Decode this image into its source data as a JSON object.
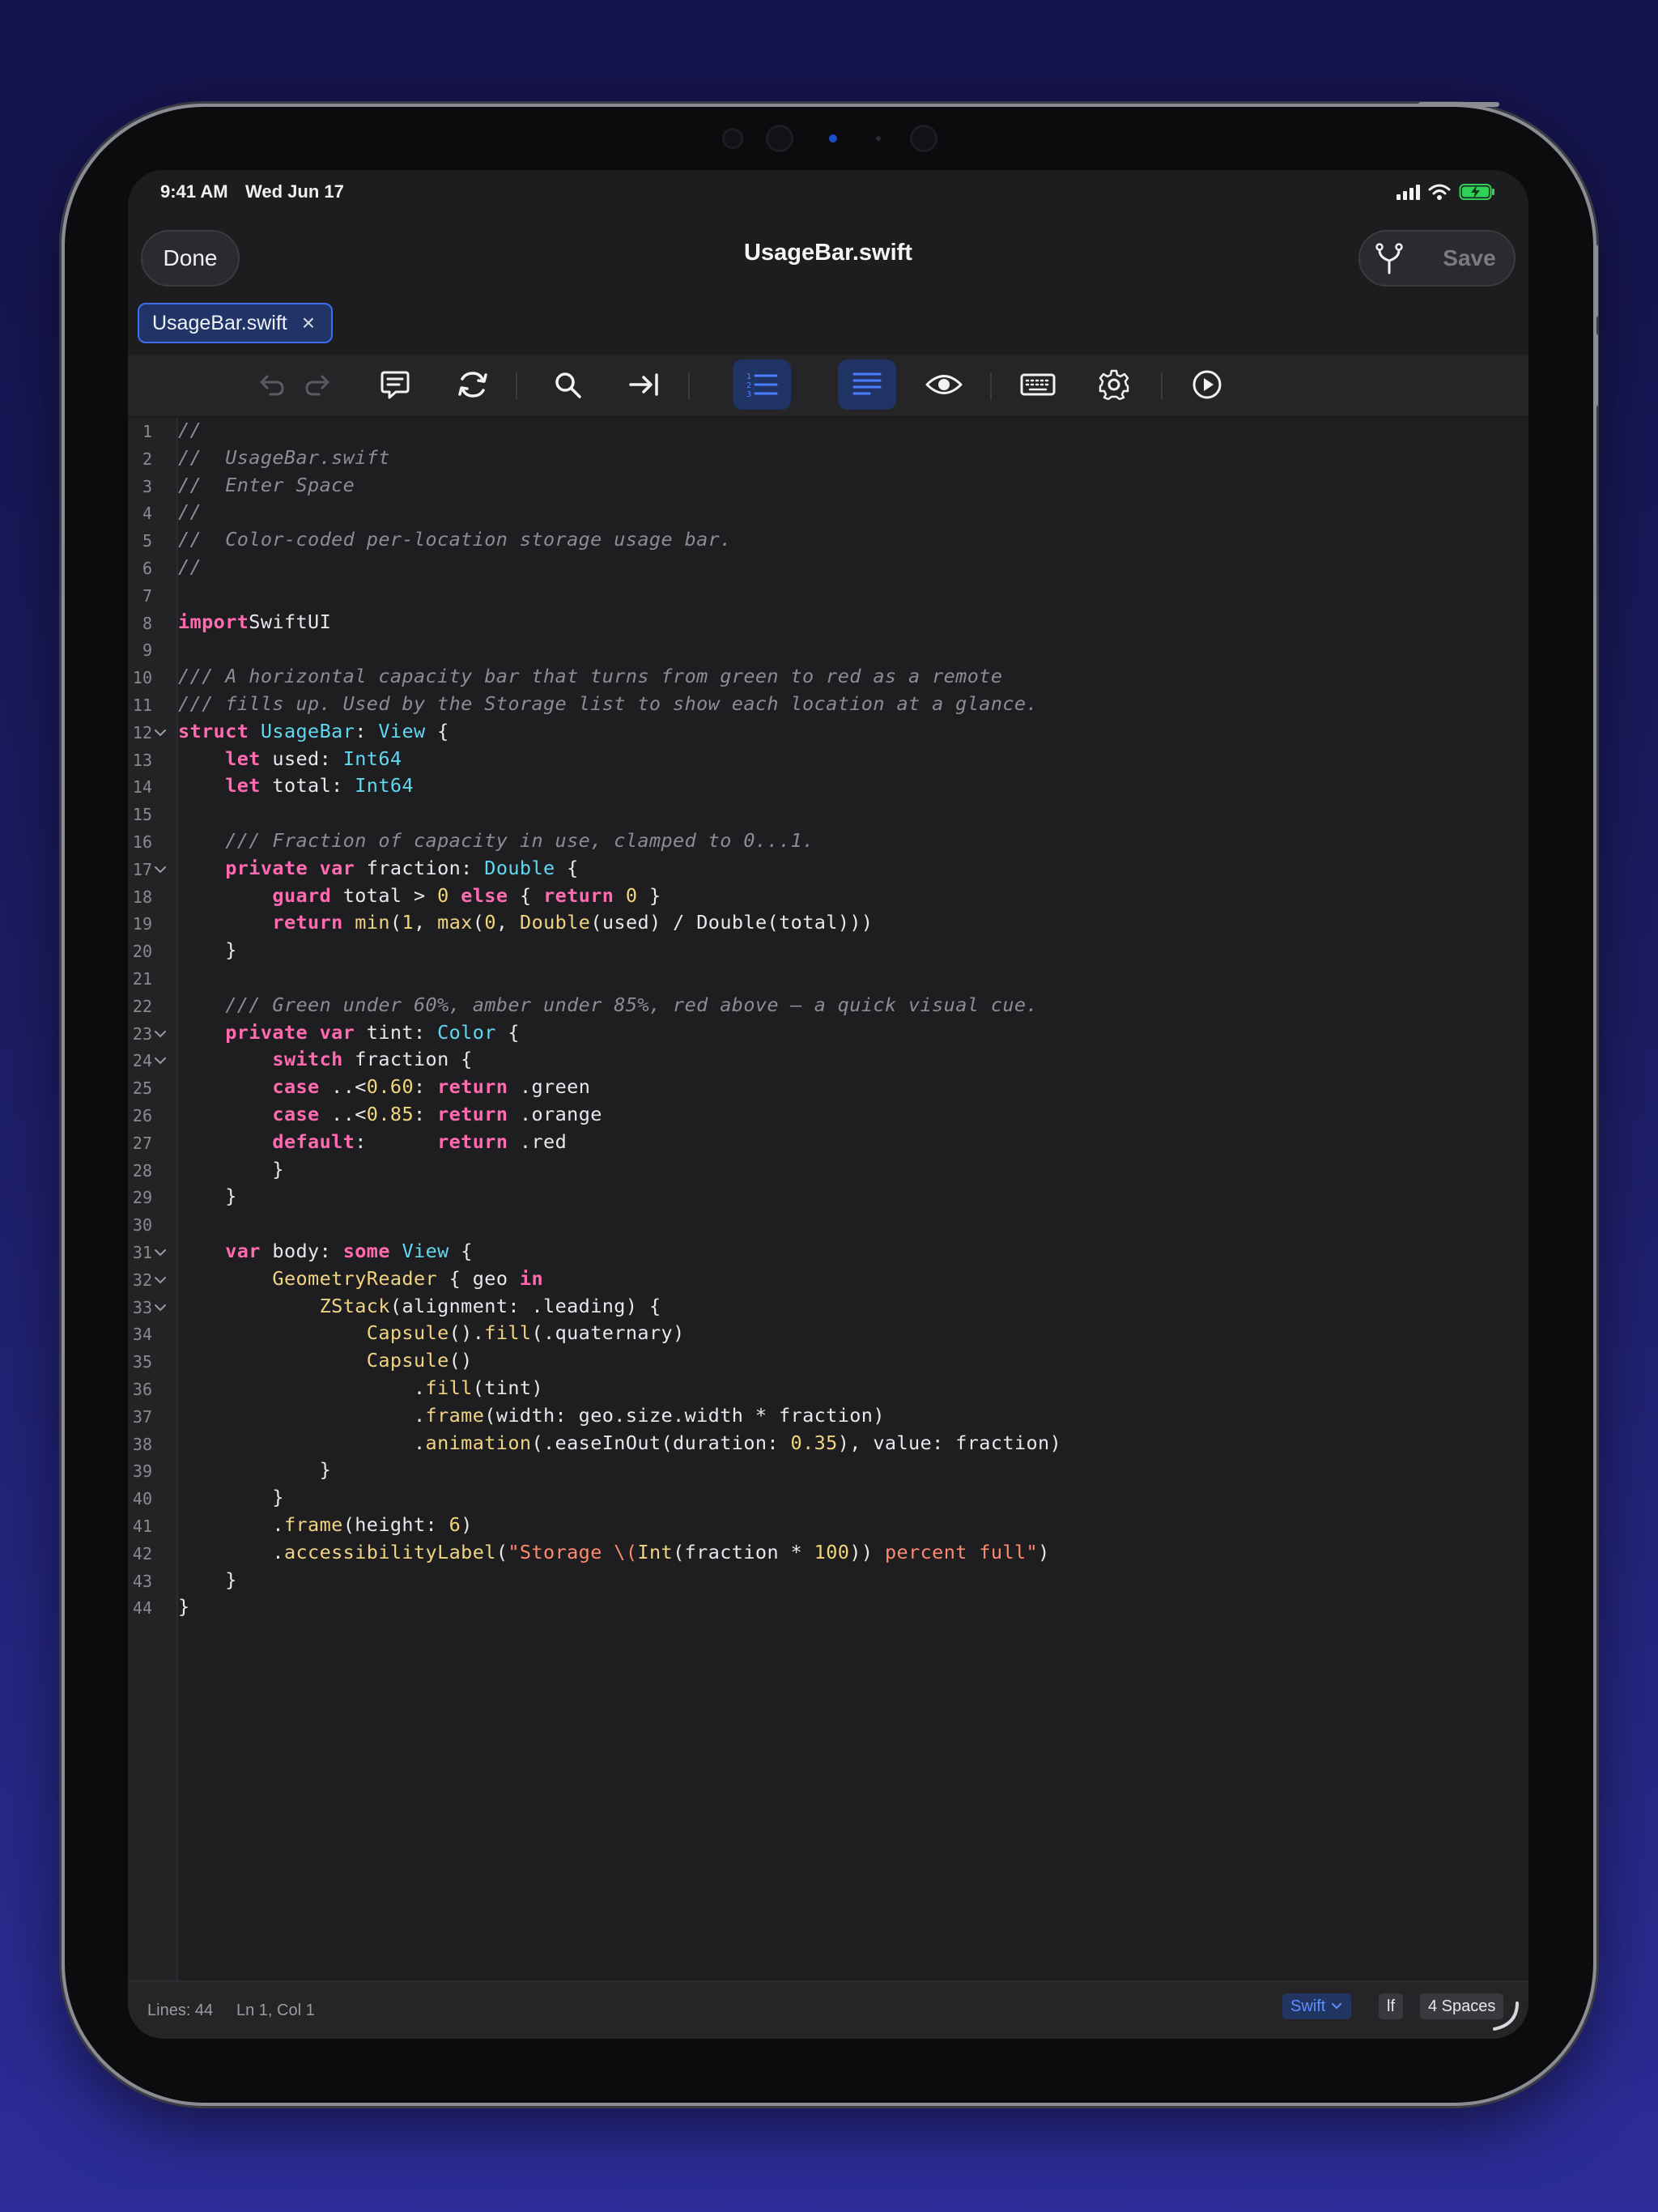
{
  "status_bar": {
    "time": "9:41 AM",
    "date": "Wed Jun 17"
  },
  "nav": {
    "done_label": "Done",
    "title": "UsageBar.swift",
    "save_label": "Save"
  },
  "tab": {
    "name": "UsageBar.swift",
    "close_glyph": "×"
  },
  "toolbar": {
    "icons": [
      "undo-icon",
      "redo-icon",
      "comment-icon",
      "refresh-icon",
      "search-icon",
      "indent-icon",
      "line-numbers-icon",
      "word-wrap-icon",
      "preview-eye-icon",
      "keyboard-icon",
      "gear-icon",
      "run-icon"
    ],
    "active": [
      "line-numbers-icon",
      "word-wrap-icon"
    ],
    "accent": "#4a7dff"
  },
  "editor": {
    "language": "Swift",
    "colors": {
      "comment": "#8a8d96",
      "keyword": "#ff6ab0",
      "type": "#5fd8f0",
      "function": "#f0d482",
      "number": "#f2d77a",
      "string": "#ff8a6e"
    },
    "fold_lines": [
      12,
      17,
      23,
      24,
      31,
      32,
      33
    ],
    "lines": [
      [
        [
          "cm",
          "//"
        ]
      ],
      [
        [
          "cm",
          "//  UsageBar.swift"
        ]
      ],
      [
        [
          "cm",
          "//  Enter Space"
        ]
      ],
      [
        [
          "cm",
          "//"
        ]
      ],
      [
        [
          "cm",
          "//  Color-coded per-location storage usage bar."
        ]
      ],
      [
        [
          "cm",
          "//"
        ]
      ],
      [],
      [
        [
          "kw",
          "import"
        ],
        [
          "",
          "SwiftUI"
        ]
      ],
      [],
      [
        [
          "cm",
          "/// A horizontal capacity bar that turns from green to red as a remote"
        ]
      ],
      [
        [
          "cm",
          "/// fills up. Used by the Storage list to show each location at a glance."
        ]
      ],
      [
        [
          "kw",
          "struct"
        ],
        [
          "",
          " "
        ],
        [
          "ty",
          "UsageBar"
        ],
        [
          "",
          ": "
        ],
        [
          "ty",
          "View"
        ],
        [
          "",
          " {"
        ]
      ],
      [
        [
          "",
          "    "
        ],
        [
          "kw",
          "let"
        ],
        [
          "",
          " used: "
        ],
        [
          "ty",
          "Int64"
        ]
      ],
      [
        [
          "",
          "    "
        ],
        [
          "kw",
          "let"
        ],
        [
          "",
          " total: "
        ],
        [
          "ty",
          "Int64"
        ]
      ],
      [],
      [
        [
          "",
          "    "
        ],
        [
          "cm",
          "/// Fraction of capacity in use, clamped to 0...1."
        ]
      ],
      [
        [
          "",
          "    "
        ],
        [
          "kw",
          "private var"
        ],
        [
          "",
          " fraction: "
        ],
        [
          "ty",
          "Double"
        ],
        [
          "",
          " {"
        ]
      ],
      [
        [
          "",
          "        "
        ],
        [
          "kw",
          "guard"
        ],
        [
          "",
          " total > "
        ],
        [
          "num",
          "0"
        ],
        [
          "",
          " "
        ],
        [
          "kw",
          "else"
        ],
        [
          "",
          " { "
        ],
        [
          "kw",
          "return"
        ],
        [
          "",
          " "
        ],
        [
          "num",
          "0"
        ],
        [
          "",
          " }"
        ]
      ],
      [
        [
          "",
          "        "
        ],
        [
          "kw",
          "return"
        ],
        [
          "",
          " "
        ],
        [
          "fn",
          "min"
        ],
        [
          "",
          "("
        ],
        [
          "num",
          "1"
        ],
        [
          "",
          ", "
        ],
        [
          "fn",
          "max"
        ],
        [
          "",
          "("
        ],
        [
          "num",
          "0"
        ],
        [
          "",
          ", "
        ],
        [
          "fn",
          "Double"
        ],
        [
          "",
          "(used) / Double(total)))"
        ]
      ],
      [
        [
          "",
          "    }"
        ]
      ],
      [],
      [
        [
          "",
          "    "
        ],
        [
          "cm",
          "/// Green under 60%, amber under 85%, red above — a quick visual cue."
        ]
      ],
      [
        [
          "",
          "    "
        ],
        [
          "kw",
          "private var"
        ],
        [
          "",
          " tint: "
        ],
        [
          "ty",
          "Color"
        ],
        [
          "",
          " {"
        ]
      ],
      [
        [
          "",
          "        "
        ],
        [
          "kw",
          "switch"
        ],
        [
          "",
          " fraction {"
        ]
      ],
      [
        [
          "",
          "        "
        ],
        [
          "kw",
          "case"
        ],
        [
          "",
          " ..<"
        ],
        [
          "num",
          "0.60"
        ],
        [
          "",
          ": "
        ],
        [
          "kw",
          "return"
        ],
        [
          "",
          " .green"
        ]
      ],
      [
        [
          "",
          "        "
        ],
        [
          "kw",
          "case"
        ],
        [
          "",
          " ..<"
        ],
        [
          "num",
          "0.85"
        ],
        [
          "",
          ": "
        ],
        [
          "kw",
          "return"
        ],
        [
          "",
          " .orange"
        ]
      ],
      [
        [
          "",
          "        "
        ],
        [
          "kw",
          "default"
        ],
        [
          "",
          ":      "
        ],
        [
          "kw",
          "return"
        ],
        [
          "",
          " .red"
        ]
      ],
      [
        [
          "",
          "        }"
        ]
      ],
      [
        [
          "",
          "    }"
        ]
      ],
      [],
      [
        [
          "",
          "    "
        ],
        [
          "kw",
          "var"
        ],
        [
          "",
          " body: "
        ],
        [
          "kw",
          "some"
        ],
        [
          "",
          " "
        ],
        [
          "ty",
          "View"
        ],
        [
          "",
          " {"
        ]
      ],
      [
        [
          "",
          "        "
        ],
        [
          "fn",
          "GeometryReader"
        ],
        [
          "",
          " { geo "
        ],
        [
          "kw",
          "in"
        ]
      ],
      [
        [
          "",
          "            "
        ],
        [
          "fn",
          "ZStack"
        ],
        [
          "",
          "(alignment: .leading) {"
        ]
      ],
      [
        [
          "",
          "                "
        ],
        [
          "fn",
          "Capsule"
        ],
        [
          "",
          "()."
        ],
        [
          "fn",
          "fill"
        ],
        [
          "",
          "(.quaternary)"
        ]
      ],
      [
        [
          "",
          "                "
        ],
        [
          "fn",
          "Capsule"
        ],
        [
          "",
          "()"
        ]
      ],
      [
        [
          "",
          "                    ."
        ],
        [
          "fn",
          "fill"
        ],
        [
          "",
          "(tint)"
        ]
      ],
      [
        [
          "",
          "                    ."
        ],
        [
          "fn",
          "frame"
        ],
        [
          "",
          "(width: geo.size.width * fraction)"
        ]
      ],
      [
        [
          "",
          "                    ."
        ],
        [
          "fn",
          "animation"
        ],
        [
          "",
          "(.easeInOut(duration: "
        ],
        [
          "num",
          "0.35"
        ],
        [
          "",
          "), value: fraction)"
        ]
      ],
      [
        [
          "",
          "            }"
        ]
      ],
      [
        [
          "",
          "        }"
        ]
      ],
      [
        [
          "",
          "        ."
        ],
        [
          "fn",
          "frame"
        ],
        [
          "",
          "(height: "
        ],
        [
          "num",
          "6"
        ],
        [
          "",
          ")"
        ]
      ],
      [
        [
          "",
          "        ."
        ],
        [
          "fn",
          "accessibilityLabel"
        ],
        [
          "",
          "("
        ],
        [
          "str",
          "\"Storage \\("
        ],
        [
          "fn",
          "Int"
        ],
        [
          "",
          "(fraction * "
        ],
        [
          "num",
          "100"
        ],
        [
          "",
          ")) "
        ],
        [
          "str",
          "percent full\""
        ],
        [
          "",
          ")"
        ]
      ],
      [
        [
          "",
          "    }"
        ]
      ],
      [
        [
          "",
          "}"
        ]
      ]
    ]
  },
  "footer": {
    "lines_label": "Lines: 44",
    "cursor_label": "Ln 1, Col 1",
    "language": "Swift",
    "line_ending": "lf",
    "indent": "4 Spaces"
  }
}
